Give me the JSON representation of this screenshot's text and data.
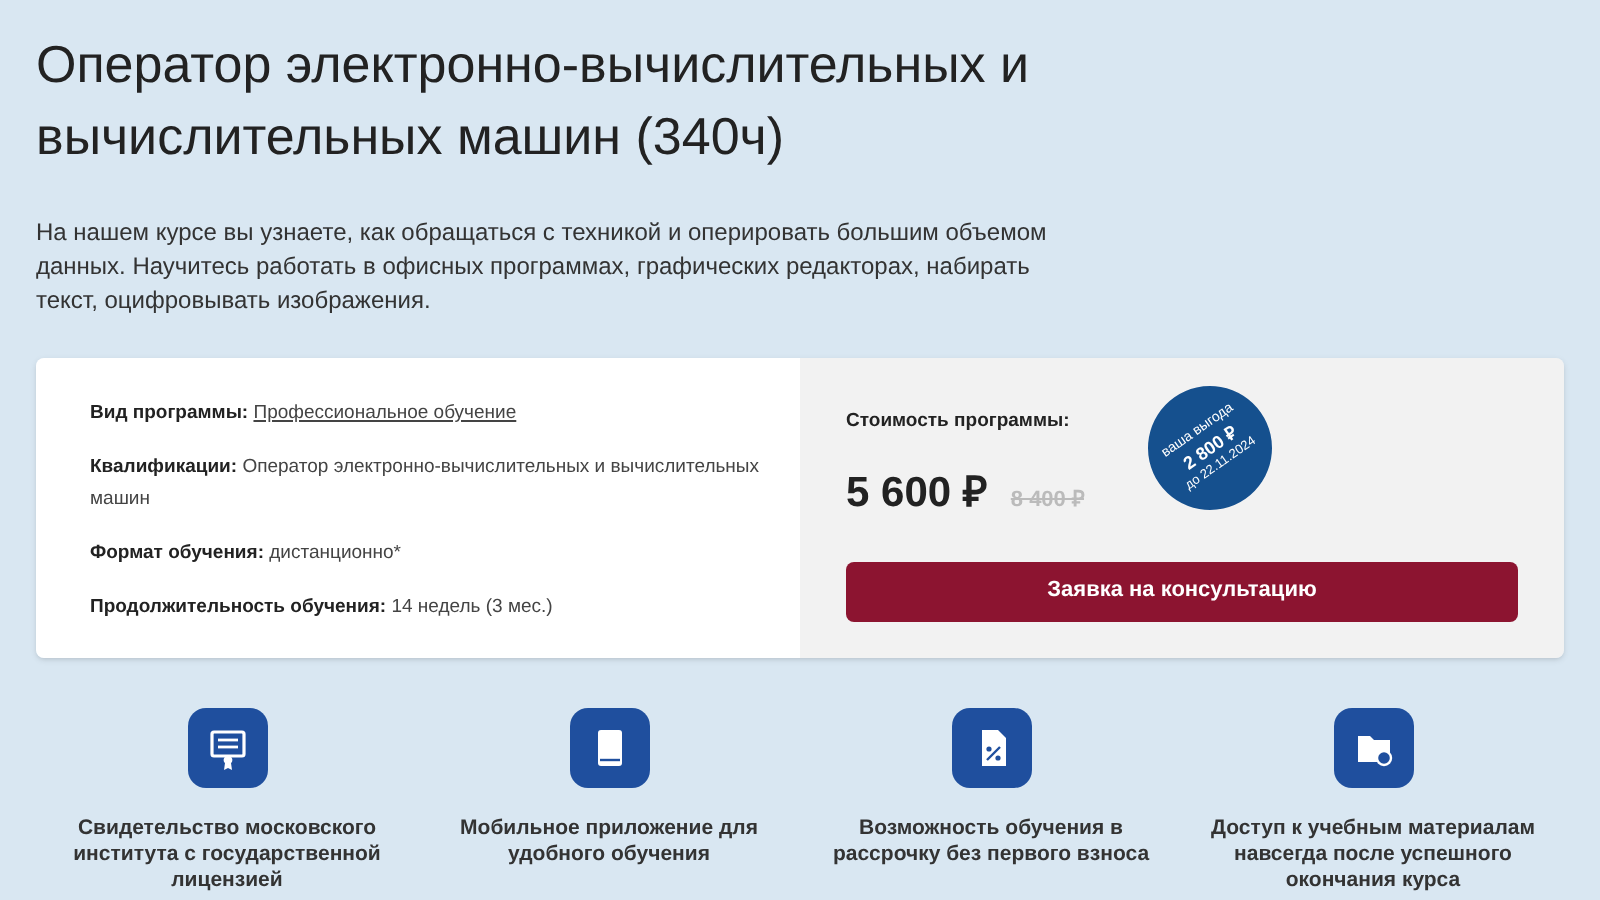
{
  "title": "Оператор электронно-вычислительных и вычислительных машин (340ч)",
  "description": "На нашем курсе вы узнаете, как обращаться с техникой и оперировать большим объемом данных. Научитесь работать в офисных программах, графических редакторах, набирать текст, оцифровывать изображения.",
  "details": [
    {
      "label": "Вид программы:",
      "value": "Профессиональное обучение",
      "kind": "link"
    },
    {
      "label": "Квалификации:",
      "value": "Оператор электронно-вычислительных и вычислительных машин",
      "kind": "text"
    },
    {
      "label": "Формат обучения:",
      "value": "дистанционно*",
      "kind": "text"
    },
    {
      "label": "Продолжительность обучения:",
      "value": "14 недель (3 мес.)",
      "kind": "text"
    }
  ],
  "price": {
    "label": "Стоимость программы:",
    "current": "5 600 ₽",
    "old": "8 400 ₽"
  },
  "badge": {
    "caption": "ваша выгода",
    "amount": "2 800 ₽",
    "until": "до 22.11.2024"
  },
  "button": "Заявка на консультацию",
  "features": [
    {
      "kind": "certificate",
      "text": "Свидетельство московского института с государственной лицензией"
    },
    {
      "kind": "book",
      "text": "Мобильное приложение для удобного обучения"
    },
    {
      "kind": "installment",
      "text": "Возможность обучения в рассрочку без первого взноса"
    },
    {
      "kind": "folder",
      "text": "Доступ к учебным материалам навсегда после успешного окончания курса"
    }
  ]
}
